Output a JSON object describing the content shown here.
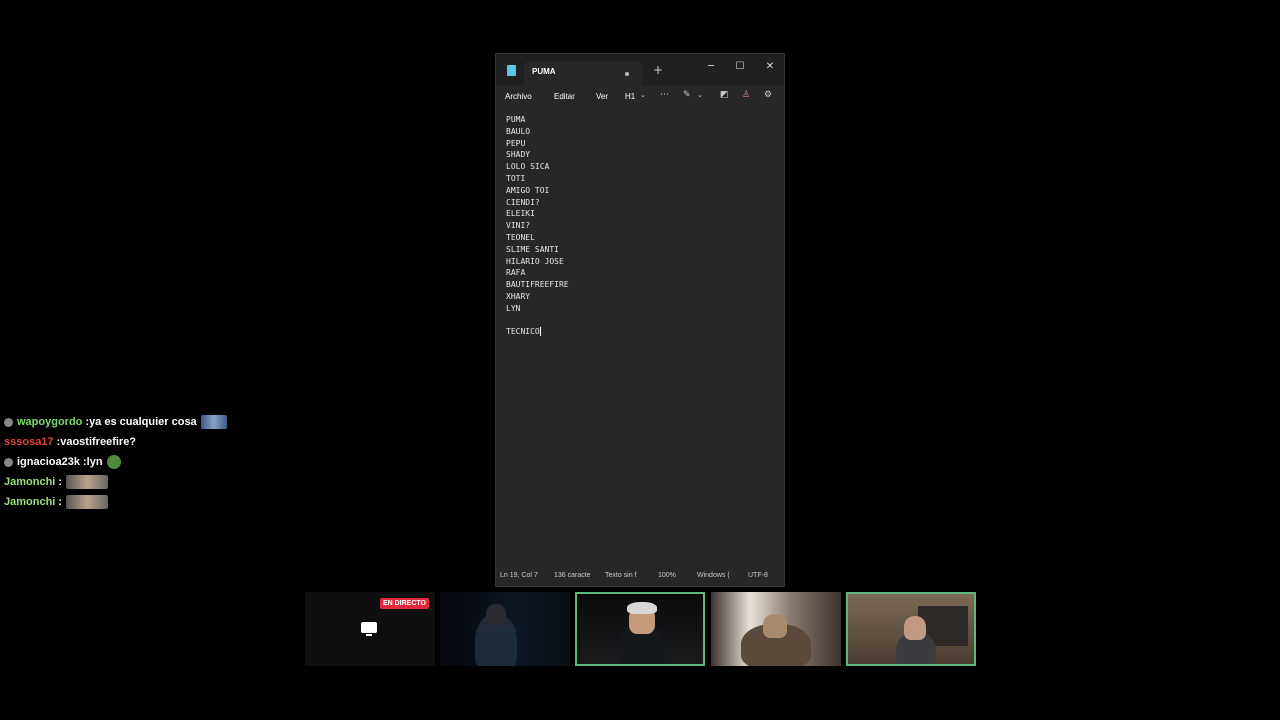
{
  "notepad": {
    "tab_title": "PUMA",
    "menu": {
      "archivo": "Archivo",
      "editar": "Editar",
      "ver": "Ver",
      "heading": "H1"
    },
    "lines": [
      "PUMA",
      "BAULO",
      "PEPU",
      "SHADY",
      "LOLO SICA",
      "TOTI",
      "AMIGO TOI",
      "CIENDI?",
      "ELEIKI",
      "VINI?",
      "TEONEL",
      "SLIME SANTI",
      "HILARIO JOSE",
      "RAFA",
      "BAUTIFREEFIRE",
      "XHARY",
      "LYN",
      "",
      "TECNICO"
    ],
    "status": {
      "position": "Ln 19, Col 7",
      "chars": "136 caracte",
      "format": "Texto sin f",
      "zoom": "100%",
      "line_ending": "Windows (",
      "encoding": "UTF-8"
    }
  },
  "chat": [
    {
      "user": "wapoygordo",
      "user_color": "#7cd96b",
      "sep": " : ",
      "text": "ya es cualquier cosa",
      "badge": true,
      "emote": "emote-image"
    },
    {
      "user": "sssosa17",
      "user_color": "#e0453b",
      "sep": " : ",
      "text": "vaostifreefire?",
      "badge": false,
      "emote": ""
    },
    {
      "user": "ignacioa23k",
      "user_color": "#ffffff",
      "sep": " : ",
      "text": "lyn",
      "badge": true,
      "emote": "pepe-emote"
    },
    {
      "user": "Jamonchi",
      "user_color": "#9be07a",
      "sep": " : ",
      "text": "",
      "badge": false,
      "emote": "emote-image"
    },
    {
      "user": "Jamonchi",
      "user_color": "#9be07a",
      "sep": " : ",
      "text": "",
      "badge": false,
      "emote": "emote-image"
    }
  ],
  "stream": {
    "live_label": "EN DIRECTO"
  }
}
